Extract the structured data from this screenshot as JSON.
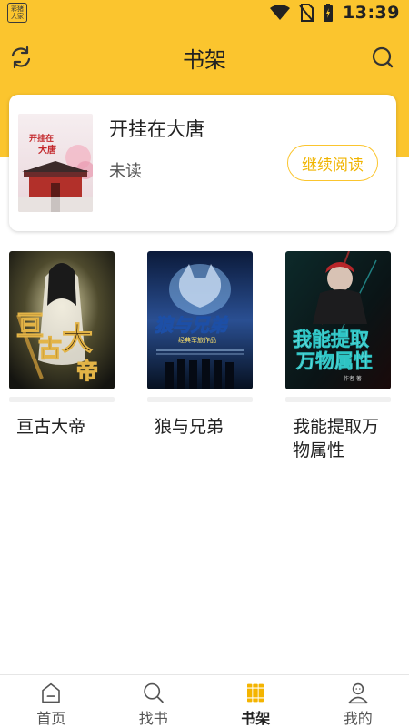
{
  "status_bar": {
    "time": "13:39",
    "app_icon_text": [
      "彩猪",
      "大家"
    ]
  },
  "header": {
    "title": "书架"
  },
  "recent_book": {
    "title": "开挂在大唐",
    "status": "未读",
    "continue_label": "继续阅读",
    "cover_text": "开挂在大唐"
  },
  "books": [
    {
      "title": "亘古大帝",
      "cover_text": "亘古大帝"
    },
    {
      "title": "狼与兄弟",
      "cover_text": "狼与兄弟"
    },
    {
      "title": "我能提取万物属性",
      "cover_text": "我能提取万物属性"
    }
  ],
  "bottom_nav": [
    {
      "label": "首页",
      "icon": "home-icon"
    },
    {
      "label": "找书",
      "icon": "search-icon"
    },
    {
      "label": "书架",
      "icon": "bookshelf-icon",
      "active": true
    },
    {
      "label": "我的",
      "icon": "profile-icon"
    }
  ],
  "colors": {
    "accent": "#fbc52e",
    "button_text": "#f0b400"
  }
}
